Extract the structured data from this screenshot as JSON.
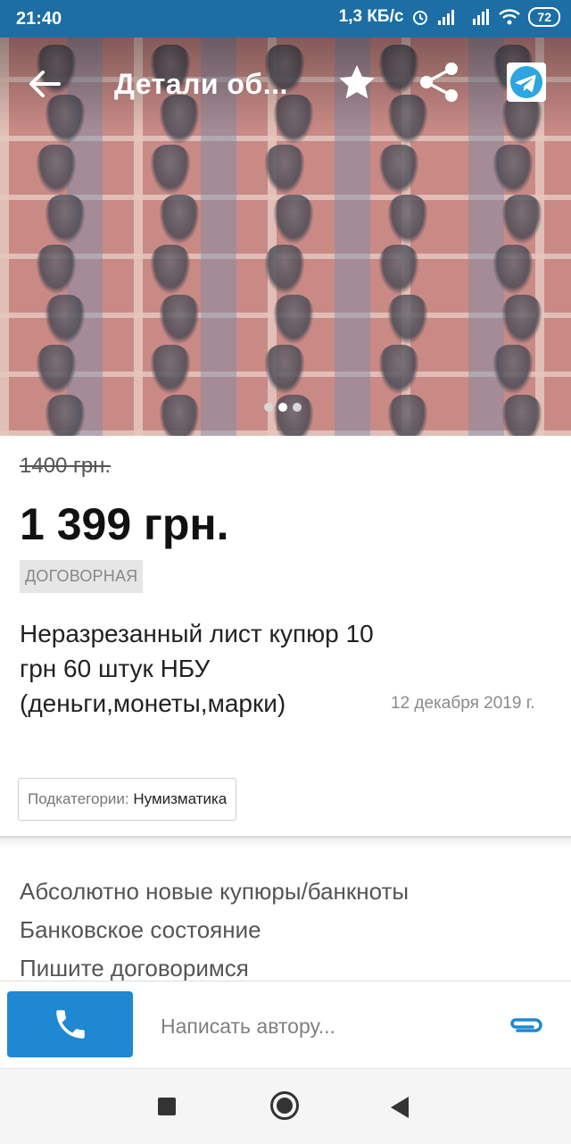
{
  "status_bar": {
    "time": "21:40",
    "network_speed": "1,3 КБ/с",
    "battery": "72"
  },
  "header": {
    "title": "Детали об..."
  },
  "gallery": {
    "page_count": 3,
    "active_page": 2
  },
  "listing": {
    "old_price": "1400 грн.",
    "price": "1 399 грн.",
    "negotiable": "ДОГОВОРНАЯ",
    "title": "Неразрезанный лист купюр 10 грн 60 штук НБУ (деньги,монеты,марки)",
    "date": "12 декабря 2019 г.",
    "subcategory_label": "Подкатегории:",
    "subcategory_value": "Нумизматика",
    "description": [
      "Абсолютно новые купюры/банкноты",
      "Банковское состояние",
      "Пишите договоримся"
    ]
  },
  "bottom_bar": {
    "message_placeholder": "Написать автору..."
  },
  "colors": {
    "status_bar": "#1c6ea4",
    "call_button": "#1e88d2",
    "telegram": "#2ca5e0",
    "attach": "#1e88d2"
  },
  "icons": [
    "back-arrow-icon",
    "star-icon",
    "share-icon",
    "telegram-icon",
    "phone-icon",
    "paperclip-icon"
  ]
}
